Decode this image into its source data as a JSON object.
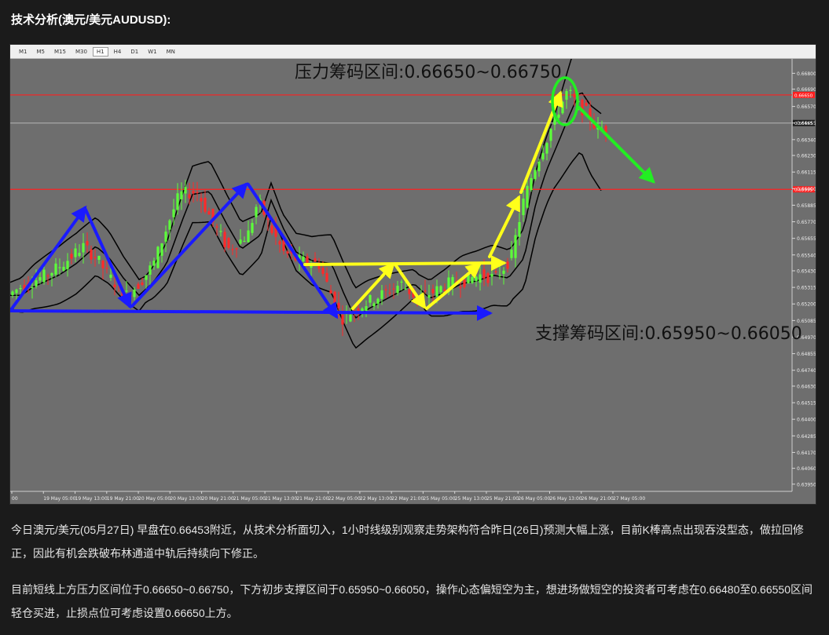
{
  "heading": "技术分析(澳元/美元AUDUSD):",
  "toolbar": {
    "timeframes": [
      "M1",
      "M5",
      "M15",
      "M30",
      "H1",
      "H4",
      "D1",
      "W1",
      "MN"
    ],
    "active": "H1"
  },
  "colors": {
    "chart_bg": "#6e6e6e",
    "bull": "#5cff3a",
    "bear": "#ff2a2a",
    "resistance_line": "#ff2020",
    "support_line": "#ff2020",
    "bollinger": "#000000",
    "pattern_blue": "#1a1aff",
    "pattern_yellow": "#ffff1a",
    "pattern_green": "#22ee22"
  },
  "chart_data": {
    "type": "candlestick",
    "symbol": "AUDUSD",
    "timeframe": "H1",
    "ylim": [
      0.639,
      0.669
    ],
    "y_tick_labels": [
      "0.66800",
      "0.66690",
      "0.66570",
      "0.66455",
      "0.66340",
      "0.66230",
      "0.66115",
      "0.66000",
      "0.65885",
      "0.65770",
      "0.65655",
      "0.65540",
      "0.65430",
      "0.65315",
      "0.65200",
      "0.65085",
      "0.64970",
      "0.64855",
      "0.64740",
      "0.64630",
      "0.64515",
      "0.64400",
      "0.64285",
      "0.64170",
      "0.64060",
      "0.63950"
    ],
    "x_tick_labels": [
      "00",
      "19 May 05:00",
      "19 May 13:00",
      "19 May 21:00",
      "20 May 05:00",
      "20 May 13:00",
      "20 May 21:00",
      "21 May 05:00",
      "21 May 13:00",
      "21 May 21:00",
      "22 May 05:00",
      "22 May 13:00",
      "22 May 21:00",
      "25 May 05:00",
      "25 May 13:00",
      "25 May 21:00",
      "26 May 05:00",
      "26 May 13:00",
      "26 May 21:00",
      "27 May 05:00"
    ],
    "current_price": 0.66455,
    "current_price_label": "0.66455",
    "resistance_price": 0.6665,
    "resistance_price_label": "0.66650",
    "support_price": 0.65995,
    "support_price_label": "0.65995",
    "resistance_annotation": "压力筹码区间:0.66650~0.66750",
    "support_annotation": "支撑筹码区间:0.65950~0.66050",
    "bollinger_bands": true,
    "grid": false
  },
  "paragraphs": [
    "今日澳元/美元(05月27日) 早盘在0.66453附近，从技术分析面切入，1小时线级别观察走势架构符合昨日(26日)预测大幅上涨，目前K棒高点出现吞没型态，做拉回修正，因此有机会跌破布林通道中轨后持续向下修正。",
    "目前短线上方压力区间位于0.66650~0.66750，下方初步支撑区间于0.65950~0.66050，操作心态偏短空为主，想进场做短空的投资者可考虑在0.66480至0.66550区间轻仓买进，止损点位可考虑设置0.66650上方。"
  ]
}
